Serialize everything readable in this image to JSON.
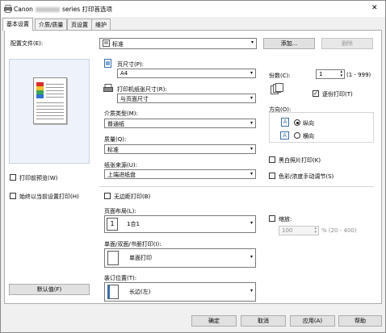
{
  "window": {
    "title_prefix": "Canon",
    "title_suffix": "series 打印首选项",
    "close_glyph": "✕"
  },
  "tabs": [
    "基本设置",
    "介质/质量",
    "页设置",
    "维护"
  ],
  "profile": {
    "label": "配置文件(E):",
    "value": "标准",
    "add_button": "添加...",
    "delete_button": "删除"
  },
  "preview_checkbox": {
    "label": "打印前预览(W)",
    "checked": false
  },
  "always_print_checkbox": {
    "label": "始终以当前设置打印(H)",
    "checked": false
  },
  "defaults_button": "默认值(F)",
  "page_size": {
    "label": "页尺寸(P):",
    "value": "A4"
  },
  "printer_paper_size": {
    "label": "打印机纸张尺寸(R):",
    "value": "与页面尺寸"
  },
  "media_type": {
    "label": "介质类型(M):",
    "value": "普通纸"
  },
  "quality": {
    "label": "质量(Q):",
    "value": "标准"
  },
  "paper_source": {
    "label": "纸张来源(U):",
    "value": "上端进纸盘"
  },
  "copies": {
    "label": "份数(C):",
    "value": "1",
    "range": "(1 - 999)"
  },
  "collate": {
    "label": "逐份打印(T)",
    "checked": true
  },
  "orientation": {
    "label": "方向(O):",
    "portrait": "纵向",
    "landscape": "横向",
    "selected": "portrait"
  },
  "grayscale": {
    "label": "黑白照片打印(K)",
    "checked": false
  },
  "color_manual": {
    "label": "色彩/浓度手动调节(S)",
    "checked": false
  },
  "borderless": {
    "label": "无边距打印(B)",
    "checked": false
  },
  "page_layout": {
    "label": "页面布局(L):",
    "value": "1合1"
  },
  "scaling": {
    "label": "缩放:",
    "checked": false,
    "value": "100",
    "range": "% (20 - 400)"
  },
  "duplex": {
    "label": "单面/双面/书册打印(I):",
    "value": "单面打印"
  },
  "stapling": {
    "label": "装订位置(T):",
    "value": "长边(左)"
  },
  "footer": {
    "ok": "确定",
    "cancel": "取消",
    "apply": "应用(A)",
    "help": "帮助"
  },
  "icons": {
    "printer": "printer-icon",
    "page_size": "page-size-icon",
    "paper_size": "printer-paper-icon"
  }
}
